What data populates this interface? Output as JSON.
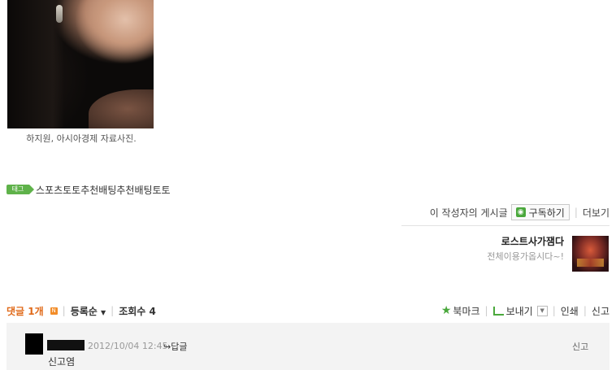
{
  "article": {
    "photo_caption": "하지원, 아시아경제 자료사진.",
    "tag_badge": "태그",
    "tag_text": "스포츠토토추천배팅추천배팅토토"
  },
  "author_bar": {
    "posts_label": "이 작성자의 게시글",
    "subscribe_label": "구독하기",
    "more_label": "더보기"
  },
  "blog": {
    "name": "로스트사가잼다",
    "description": "전체이용가옵시다~!"
  },
  "comments_bar": {
    "count_label": "댓글 1개",
    "new_badge": "N",
    "sort_label": "등록순",
    "views_label": "조회수 4",
    "bookmark_label": "북마크",
    "send_label": "보내기",
    "print_label": "인쇄",
    "report_label": "신고"
  },
  "comments": [
    {
      "date": "2012/10/04 12:45",
      "reply_label": "답글",
      "report_label": "신고",
      "text": "신고염"
    }
  ],
  "colors": {
    "accent_green": "#4aa83c",
    "comment_count": "#e06a1a",
    "comment_bg": "#f3f3f3"
  }
}
